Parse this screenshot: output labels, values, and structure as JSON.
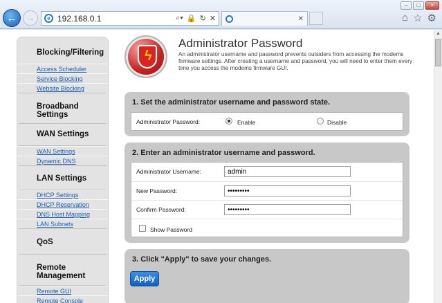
{
  "browser": {
    "url": "192.168.0.1",
    "tab_title": "",
    "window_controls": {
      "minimize": "–",
      "maximize": "□",
      "close": "×"
    },
    "icons": [
      "back-arrow-icon",
      "forward-arrow-icon",
      "ie-logo-icon",
      "search-icon",
      "lock-icon",
      "refresh-icon",
      "close-icon",
      "home-icon",
      "star-icon",
      "gear-icon"
    ]
  },
  "sidebar": {
    "groups": [
      {
        "title": "Blocking/Filtering",
        "links": [
          "Access Scheduler",
          "Service Blocking",
          "Website Blocking"
        ]
      },
      {
        "title": "Broadband Settings",
        "links": []
      },
      {
        "title": "WAN Settings",
        "links": [
          "WAN Settings",
          "Dynamic DNS"
        ]
      },
      {
        "title": "LAN Settings",
        "links": [
          "DHCP Settings",
          "DHCP Reservation",
          "DNS Host Mapping",
          "LAN Subnets"
        ]
      },
      {
        "title": "QoS",
        "links": []
      },
      {
        "title": "Remote Management",
        "links": [
          "Remote GUI",
          "Remote Console"
        ]
      }
    ]
  },
  "header": {
    "title": "Administrator Password",
    "description": "An administrator username and password prevents outsiders from accessing the modems firmware settings. After creating a username and password, you will need to enter them every time you access the modems firmware GUI."
  },
  "section1": {
    "heading": "1. Set the administrator username and password state.",
    "label": "Administrator Password:",
    "enable_label": "Enable",
    "disable_label": "Disable",
    "selected": "Enable"
  },
  "section2": {
    "heading": "2. Enter an administrator username and password.",
    "username_label": "Administrator Username:",
    "username_value": "admin",
    "new_password_label": "New Password:",
    "new_password_value": "•••••••••",
    "confirm_password_label": "Confirm Password:",
    "confirm_password_value": "•••••••••",
    "show_password_label": "Show Password",
    "show_password_checked": false
  },
  "section3": {
    "heading": "3. Click \"Apply\" to save your changes.",
    "apply_label": "Apply"
  }
}
